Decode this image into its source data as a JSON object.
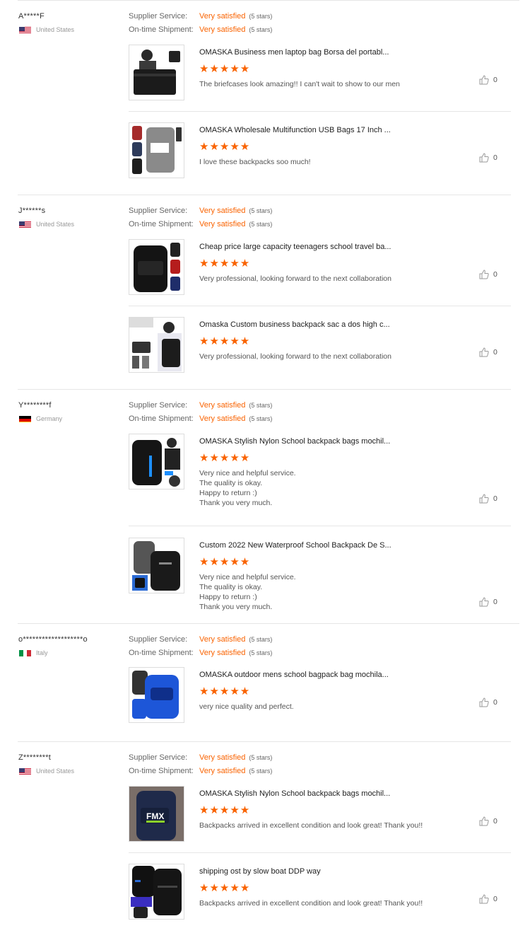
{
  "colors": {
    "accent": "#f96302",
    "rule": "#e6e6e6"
  },
  "labels": {
    "supplier_service": "Supplier Service:",
    "on_time_shipment": "On-time Shipment:"
  },
  "reviews": [
    {
      "name": "A*****F",
      "country": "United States",
      "flag_icon": "us-flag-icon",
      "supplier_service": {
        "value": "Very satisfied",
        "stars": "(5 stars)"
      },
      "on_time_shipment": {
        "value": "Very satisfied",
        "stars": "(5 stars)"
      },
      "items": [
        {
          "title": "OMASKA Business men laptop bag Borsa del portabl...",
          "rating": 5,
          "stars": "★★★★★",
          "comment": "The briefcases look amazing!! I can't wait to show to our men",
          "likes": "0"
        },
        {
          "title": "OMASKA Wholesale Multifunction USB Bags 17 Inch ...",
          "rating": 5,
          "stars": "★★★★★",
          "comment": "I love these backpacks soo much!",
          "likes": "0"
        }
      ]
    },
    {
      "name": "J******s",
      "country": "United States",
      "flag_icon": "us-flag-icon",
      "supplier_service": {
        "value": "Very satisfied",
        "stars": "(5 stars)"
      },
      "on_time_shipment": {
        "value": "Very satisfied",
        "stars": "(5 stars)"
      },
      "items": [
        {
          "title": "Cheap price large capacity teenagers school travel ba...",
          "rating": 5,
          "stars": "★★★★★",
          "comment": "Very professional, looking forward to the next collaboration",
          "likes": "0"
        },
        {
          "title": "Omaska Custom business backpack sac a dos high c...",
          "rating": 5,
          "stars": "★★★★★",
          "comment": "Very professional, looking forward to the next collaboration",
          "likes": "0"
        }
      ]
    },
    {
      "name": "Y********f",
      "country": "Germany",
      "flag_icon": "de-flag-icon",
      "supplier_service": {
        "value": "Very satisfied",
        "stars": "(5 stars)"
      },
      "on_time_shipment": {
        "value": "Very satisfied",
        "stars": "(5 stars)"
      },
      "items": [
        {
          "title": "OMASKA Stylish Nylon School backpack bags mochil...",
          "rating": 5,
          "stars": "★★★★★",
          "comment": "Very nice and helpful service.\nThe quality is okay.\nHappy to return :)\nThank you very much.",
          "likes": "0"
        },
        {
          "title": "Custom 2022 New Waterproof School Backpack De S...",
          "rating": 5,
          "stars": "★★★★★",
          "comment": "Very nice and helpful service.\nThe quality is okay.\nHappy to return :)\nThank you very much.",
          "likes": "0"
        }
      ]
    },
    {
      "name": "o*******************o",
      "country": "Italy",
      "flag_icon": "it-flag-icon",
      "supplier_service": {
        "value": "Very satisfied",
        "stars": "(5 stars)"
      },
      "on_time_shipment": {
        "value": "Very satisfied",
        "stars": "(5 stars)"
      },
      "items": [
        {
          "title": "OMASKA outdoor mens school bagpack bag mochila...",
          "rating": 5,
          "stars": "★★★★★",
          "comment": "very nice quality and perfect.",
          "likes": "0"
        }
      ]
    },
    {
      "name": "Z********t",
      "country": "United States",
      "flag_icon": "us-flag-icon",
      "supplier_service": {
        "value": "Very satisfied",
        "stars": "(5 stars)"
      },
      "on_time_shipment": {
        "value": "Very satisfied",
        "stars": "(5 stars)"
      },
      "items": [
        {
          "title": "OMASKA Stylish Nylon School backpack bags mochil...",
          "rating": 5,
          "stars": "★★★★★",
          "comment": "Backpacks arrived in excellent condition and look great! Thank you!!",
          "likes": "0",
          "thumb_text": "FMX"
        },
        {
          "title": "shipping ost by slow boat DDP way",
          "rating": 5,
          "stars": "★★★★★",
          "comment": "Backpacks arrived in excellent condition and look great! Thank you!!",
          "likes": "0"
        }
      ]
    }
  ]
}
